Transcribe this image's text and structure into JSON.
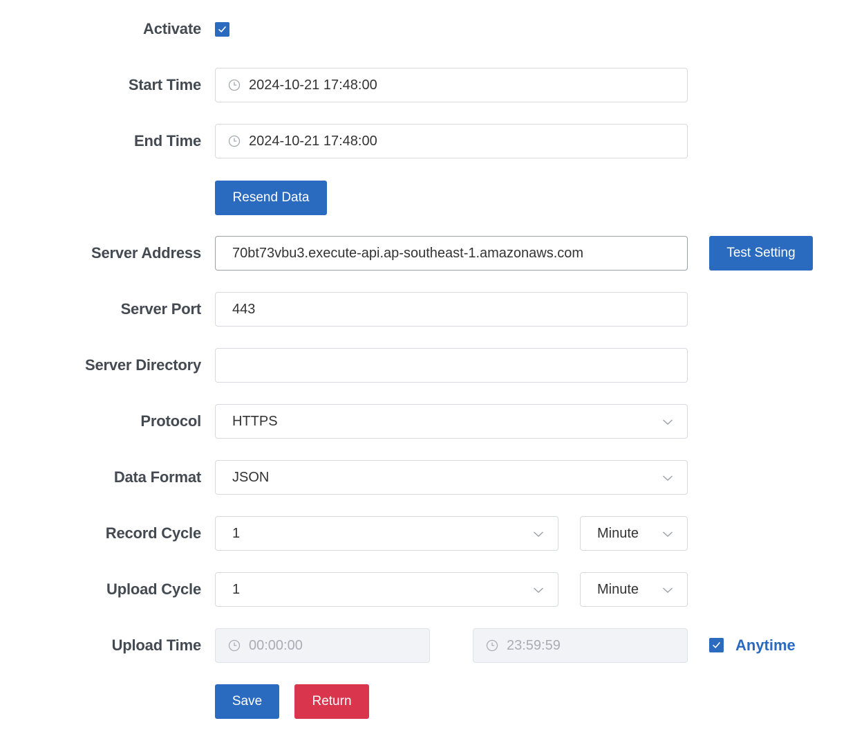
{
  "form": {
    "activate": {
      "label": "Activate",
      "checked": true
    },
    "start_time": {
      "label": "Start Time",
      "value": "2024-10-21 17:48:00"
    },
    "end_time": {
      "label": "End Time",
      "value": "2024-10-21 17:48:00"
    },
    "resend_button": "Resend Data",
    "server_address": {
      "label": "Server Address",
      "value": "70bt73vbu3.execute-api.ap-southeast-1.amazonaws.com"
    },
    "test_button": "Test Setting",
    "server_port": {
      "label": "Server Port",
      "value": "443"
    },
    "server_directory": {
      "label": "Server Directory",
      "value": ""
    },
    "protocol": {
      "label": "Protocol",
      "value": "HTTPS"
    },
    "data_format": {
      "label": "Data Format",
      "value": "JSON"
    },
    "record_cycle": {
      "label": "Record Cycle",
      "value": "1",
      "unit": "Minute"
    },
    "upload_cycle": {
      "label": "Upload Cycle",
      "value": "1",
      "unit": "Minute"
    },
    "upload_time": {
      "label": "Upload Time",
      "start": "00:00:00",
      "end": "23:59:59",
      "anytime_label": "Anytime",
      "anytime_checked": true
    },
    "save_button": "Save",
    "return_button": "Return"
  },
  "colors": {
    "primary": "#2b6bbf",
    "danger": "#d9364d",
    "label": "#444a52",
    "border": "#d6d9de",
    "disabled_bg": "#f1f3f6"
  },
  "icons": [
    "clock-icon",
    "chevron-down-icon",
    "checkmark-icon"
  ]
}
